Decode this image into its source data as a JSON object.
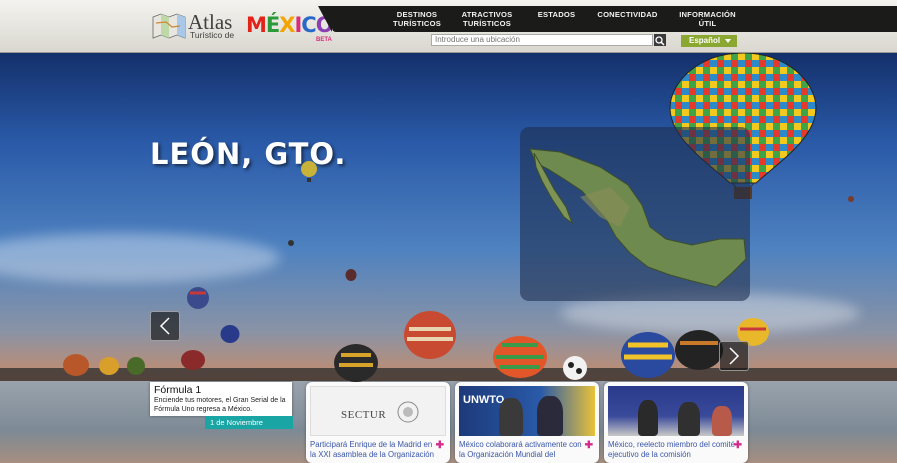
{
  "header": {
    "logo": {
      "atlas": "Atlas",
      "subtitle": "Turístico de",
      "country": "MÉXICO",
      "badge": "BETA"
    },
    "nav": [
      {
        "line1": "DESTINOS",
        "line2": "TURÍSTICOS"
      },
      {
        "line1": "ATRACTIVOS",
        "line2": "TURÍSTICOS"
      },
      {
        "line1": "ESTADOS",
        "line2": ""
      },
      {
        "line1": "CONECTIVIDAD",
        "line2": ""
      },
      {
        "line1": "INFORMACIÓN",
        "line2": "ÚTIL"
      }
    ],
    "search": {
      "placeholder": "Introduce una ubicación"
    },
    "language": "Español"
  },
  "hero": {
    "title": "LEÓN, GTO."
  },
  "news": {
    "featured": {
      "title": "Fórmula 1",
      "description": "Enciende tus motores, el Gran Serial de la Fórmula Uno regresa a México.",
      "date": "1 de Noviembre"
    },
    "cards": [
      {
        "text": "Participará Enrique de la Madrid en la XXI asamblea de la Organización",
        "image_label": "SECTUR"
      },
      {
        "text": "México colaborará activamente con la Organización Mundial del",
        "image_label": "UNWTO"
      },
      {
        "text": "México, reelecto miembro del comité ejecutivo de la comisión",
        "image_label": ""
      }
    ]
  },
  "colors": {
    "nav_bg": "#1b1b19",
    "accent_green": "#8aa831",
    "date_teal": "#1aa5a5",
    "link_blue": "#3a57a8",
    "plus_pink": "#d62b8a"
  }
}
